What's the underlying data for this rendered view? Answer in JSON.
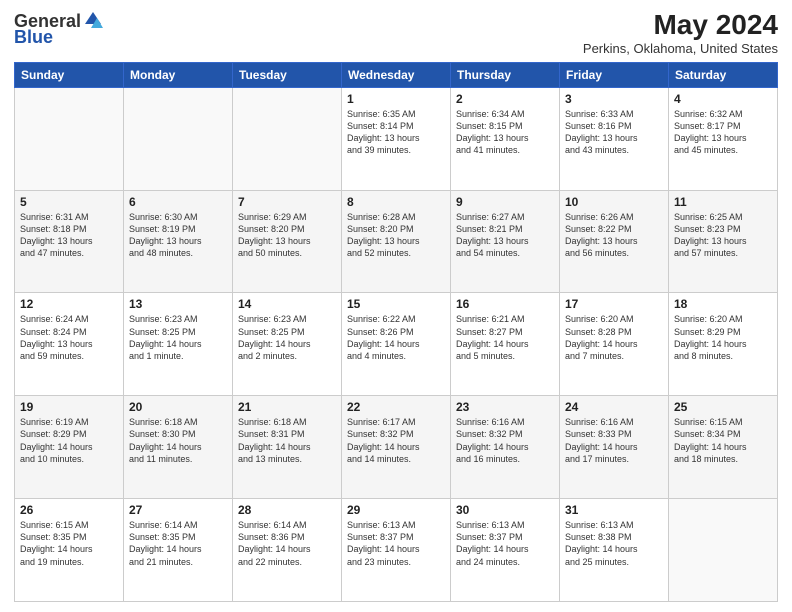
{
  "header": {
    "logo_general": "General",
    "logo_blue": "Blue",
    "month_year": "May 2024",
    "location": "Perkins, Oklahoma, United States"
  },
  "days_of_week": [
    "Sunday",
    "Monday",
    "Tuesday",
    "Wednesday",
    "Thursday",
    "Friday",
    "Saturday"
  ],
  "weeks": [
    [
      {
        "day": "",
        "info": ""
      },
      {
        "day": "",
        "info": ""
      },
      {
        "day": "",
        "info": ""
      },
      {
        "day": "1",
        "info": "Sunrise: 6:35 AM\nSunset: 8:14 PM\nDaylight: 13 hours\nand 39 minutes."
      },
      {
        "day": "2",
        "info": "Sunrise: 6:34 AM\nSunset: 8:15 PM\nDaylight: 13 hours\nand 41 minutes."
      },
      {
        "day": "3",
        "info": "Sunrise: 6:33 AM\nSunset: 8:16 PM\nDaylight: 13 hours\nand 43 minutes."
      },
      {
        "day": "4",
        "info": "Sunrise: 6:32 AM\nSunset: 8:17 PM\nDaylight: 13 hours\nand 45 minutes."
      }
    ],
    [
      {
        "day": "5",
        "info": "Sunrise: 6:31 AM\nSunset: 8:18 PM\nDaylight: 13 hours\nand 47 minutes."
      },
      {
        "day": "6",
        "info": "Sunrise: 6:30 AM\nSunset: 8:19 PM\nDaylight: 13 hours\nand 48 minutes."
      },
      {
        "day": "7",
        "info": "Sunrise: 6:29 AM\nSunset: 8:20 PM\nDaylight: 13 hours\nand 50 minutes."
      },
      {
        "day": "8",
        "info": "Sunrise: 6:28 AM\nSunset: 8:20 PM\nDaylight: 13 hours\nand 52 minutes."
      },
      {
        "day": "9",
        "info": "Sunrise: 6:27 AM\nSunset: 8:21 PM\nDaylight: 13 hours\nand 54 minutes."
      },
      {
        "day": "10",
        "info": "Sunrise: 6:26 AM\nSunset: 8:22 PM\nDaylight: 13 hours\nand 56 minutes."
      },
      {
        "day": "11",
        "info": "Sunrise: 6:25 AM\nSunset: 8:23 PM\nDaylight: 13 hours\nand 57 minutes."
      }
    ],
    [
      {
        "day": "12",
        "info": "Sunrise: 6:24 AM\nSunset: 8:24 PM\nDaylight: 13 hours\nand 59 minutes."
      },
      {
        "day": "13",
        "info": "Sunrise: 6:23 AM\nSunset: 8:25 PM\nDaylight: 14 hours\nand 1 minute."
      },
      {
        "day": "14",
        "info": "Sunrise: 6:23 AM\nSunset: 8:25 PM\nDaylight: 14 hours\nand 2 minutes."
      },
      {
        "day": "15",
        "info": "Sunrise: 6:22 AM\nSunset: 8:26 PM\nDaylight: 14 hours\nand 4 minutes."
      },
      {
        "day": "16",
        "info": "Sunrise: 6:21 AM\nSunset: 8:27 PM\nDaylight: 14 hours\nand 5 minutes."
      },
      {
        "day": "17",
        "info": "Sunrise: 6:20 AM\nSunset: 8:28 PM\nDaylight: 14 hours\nand 7 minutes."
      },
      {
        "day": "18",
        "info": "Sunrise: 6:20 AM\nSunset: 8:29 PM\nDaylight: 14 hours\nand 8 minutes."
      }
    ],
    [
      {
        "day": "19",
        "info": "Sunrise: 6:19 AM\nSunset: 8:29 PM\nDaylight: 14 hours\nand 10 minutes."
      },
      {
        "day": "20",
        "info": "Sunrise: 6:18 AM\nSunset: 8:30 PM\nDaylight: 14 hours\nand 11 minutes."
      },
      {
        "day": "21",
        "info": "Sunrise: 6:18 AM\nSunset: 8:31 PM\nDaylight: 14 hours\nand 13 minutes."
      },
      {
        "day": "22",
        "info": "Sunrise: 6:17 AM\nSunset: 8:32 PM\nDaylight: 14 hours\nand 14 minutes."
      },
      {
        "day": "23",
        "info": "Sunrise: 6:16 AM\nSunset: 8:32 PM\nDaylight: 14 hours\nand 16 minutes."
      },
      {
        "day": "24",
        "info": "Sunrise: 6:16 AM\nSunset: 8:33 PM\nDaylight: 14 hours\nand 17 minutes."
      },
      {
        "day": "25",
        "info": "Sunrise: 6:15 AM\nSunset: 8:34 PM\nDaylight: 14 hours\nand 18 minutes."
      }
    ],
    [
      {
        "day": "26",
        "info": "Sunrise: 6:15 AM\nSunset: 8:35 PM\nDaylight: 14 hours\nand 19 minutes."
      },
      {
        "day": "27",
        "info": "Sunrise: 6:14 AM\nSunset: 8:35 PM\nDaylight: 14 hours\nand 21 minutes."
      },
      {
        "day": "28",
        "info": "Sunrise: 6:14 AM\nSunset: 8:36 PM\nDaylight: 14 hours\nand 22 minutes."
      },
      {
        "day": "29",
        "info": "Sunrise: 6:13 AM\nSunset: 8:37 PM\nDaylight: 14 hours\nand 23 minutes."
      },
      {
        "day": "30",
        "info": "Sunrise: 6:13 AM\nSunset: 8:37 PM\nDaylight: 14 hours\nand 24 minutes."
      },
      {
        "day": "31",
        "info": "Sunrise: 6:13 AM\nSunset: 8:38 PM\nDaylight: 14 hours\nand 25 minutes."
      },
      {
        "day": "",
        "info": ""
      }
    ]
  ],
  "colors": {
    "header_bg": "#2255aa",
    "header_text": "#ffffff",
    "border": "#cccccc",
    "shade_row": "#f5f5f5"
  }
}
